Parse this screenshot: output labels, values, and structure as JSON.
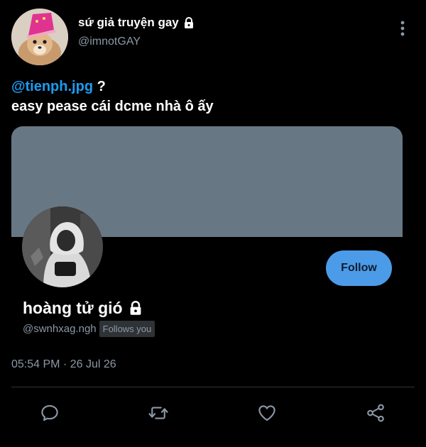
{
  "author": {
    "name": "sứ giả truyện gay",
    "handle": "@imnotGAY",
    "avatar_icon": "chihuahua-avatar"
  },
  "tweet": {
    "mention": "@tienph.jpg",
    "mention_suffix": " ?",
    "line2": "easy pease cái dcme nhà ô ấy"
  },
  "profile_card": {
    "banner_color": "#687784",
    "name": "hoàng tử gió",
    "handle": "@swnhxag.ngh",
    "follows_badge": "Follows you",
    "follow_label": "Follow",
    "avatar_icon": "hooded-person-avatar"
  },
  "meta": {
    "timestamp": "05:54 PM · 26 Jul 26"
  },
  "actions": [
    {
      "name": "reply",
      "icon": "reply-icon"
    },
    {
      "name": "retweet",
      "icon": "retweet-icon"
    },
    {
      "name": "like",
      "icon": "heart-icon"
    },
    {
      "name": "share",
      "icon": "share-icon"
    }
  ],
  "colors": {
    "background": "#000000",
    "accent": "#1d9bf0",
    "follow_button": "#4c9be8",
    "muted_text": "#8b98a5"
  }
}
